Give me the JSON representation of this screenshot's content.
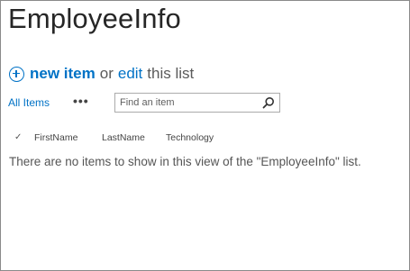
{
  "list": {
    "title": "EmployeeInfo",
    "new_item_label": "new item",
    "or_text": "or",
    "edit_label": "edit",
    "this_list_text": "this list"
  },
  "view": {
    "all_items_label": "All Items",
    "more_label": "•••"
  },
  "search": {
    "placeholder": "Find an item",
    "icon": "search-icon"
  },
  "columns": {
    "check_glyph": "✓",
    "headers": [
      "FirstName",
      "LastName",
      "Technology"
    ]
  },
  "empty_message": "There are no items to show in this view of the \"EmployeeInfo\" list.",
  "colors": {
    "accent": "#0072c6",
    "title_text": "#262626"
  }
}
